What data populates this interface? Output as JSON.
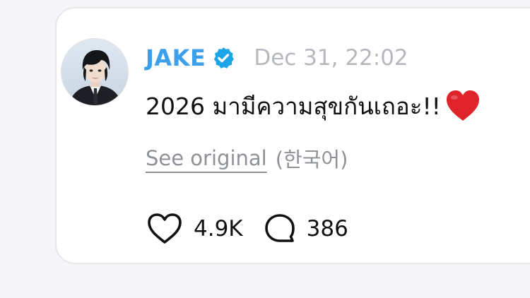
{
  "post": {
    "author": "JAKE",
    "timestamp": "Dec 31, 22:02",
    "text": "2026 มามีความสุขกันเถอะ!!",
    "translation": {
      "link_label": "See original",
      "language": "(한국어)"
    },
    "likes": "4.9K",
    "replies": "386"
  },
  "icons": {
    "verified": "verified-badge-icon",
    "emoji": "red-heart-emoji",
    "like": "heart-outline-icon",
    "reply": "speech-bubble-outline-icon"
  },
  "colors": {
    "username": "#3b9fec",
    "timestamp": "#b5b8bd",
    "muted": "#8e9196",
    "text": "#111111",
    "heart_emoji": "#e0242b"
  }
}
